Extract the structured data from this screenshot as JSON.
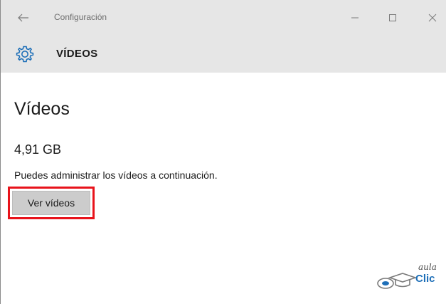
{
  "titlebar": {
    "title": "Configuración",
    "icons": {
      "back": "back-arrow-icon",
      "minimize": "minimize-icon",
      "maximize": "maximize-icon",
      "close": "close-icon"
    }
  },
  "header": {
    "section_title": "VÍDEOS",
    "icon": "gear-icon",
    "accent_color": "#1e6fb8"
  },
  "main": {
    "heading": "Vídeos",
    "size": "4,91 GB",
    "description": "Puedes administrar los vídeos a continuación.",
    "button_label": "Ver vídeos",
    "highlight_color": "#e8131b"
  },
  "logo": {
    "top": "aula",
    "bottom": "Clic"
  }
}
